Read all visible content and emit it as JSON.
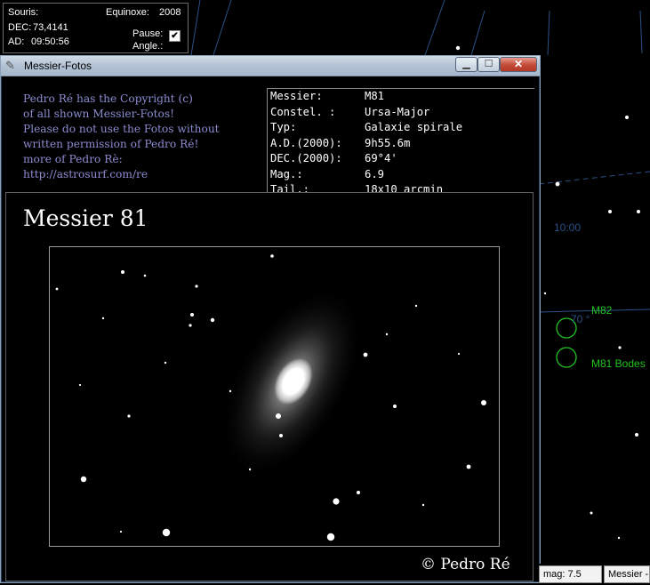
{
  "info_panel": {
    "souris_label": "Souris:",
    "equinoxe_label": "Equinoxe:",
    "equinoxe_value": "2008",
    "dec_label": "DEC:",
    "dec_value": "73,4141",
    "ad_label": "AD:",
    "ad_value": "09:50:56",
    "pause_label": "Pause:",
    "pause_checked": true,
    "angle_label": "Angle.:"
  },
  "window": {
    "title": "Messier-Fotos",
    "copyright_lines": [
      "Pedro Ré  has the Copyright (c)",
      "of all shown Messier-Fotos!",
      "Please do not use the Fotos without",
      "written permission of Pedro Ré!",
      "more of Pedro Rè:",
      "http://astrosurf.com/re"
    ],
    "details": [
      {
        "key": "Messier:",
        "value": "M81"
      },
      {
        "key": "Constel. :",
        "value": "Ursa-Major"
      },
      {
        "key": "Typ:",
        "value": "Galaxie spirale"
      },
      {
        "key": "A.D.(2000):",
        "value": "9h55.6m"
      },
      {
        "key": "DEC.(2000):",
        "value": "69°4'"
      },
      {
        "key": "Mag.:",
        "value": "6.9"
      },
      {
        "key": "Tail.:",
        "value": "18x10 arcmin"
      }
    ],
    "photo_title": "Messier 81",
    "photo_credit": "© Pedro Ré"
  },
  "sky": {
    "time_label": "10:00",
    "dec_line_label": "70 °",
    "objects": [
      "M82",
      "M81 Bodes"
    ],
    "object_color": "#22c322",
    "grid_color": "#2c4f86"
  },
  "statusbar": {
    "mag": "mag: 7.5",
    "tab": "Messier -"
  }
}
